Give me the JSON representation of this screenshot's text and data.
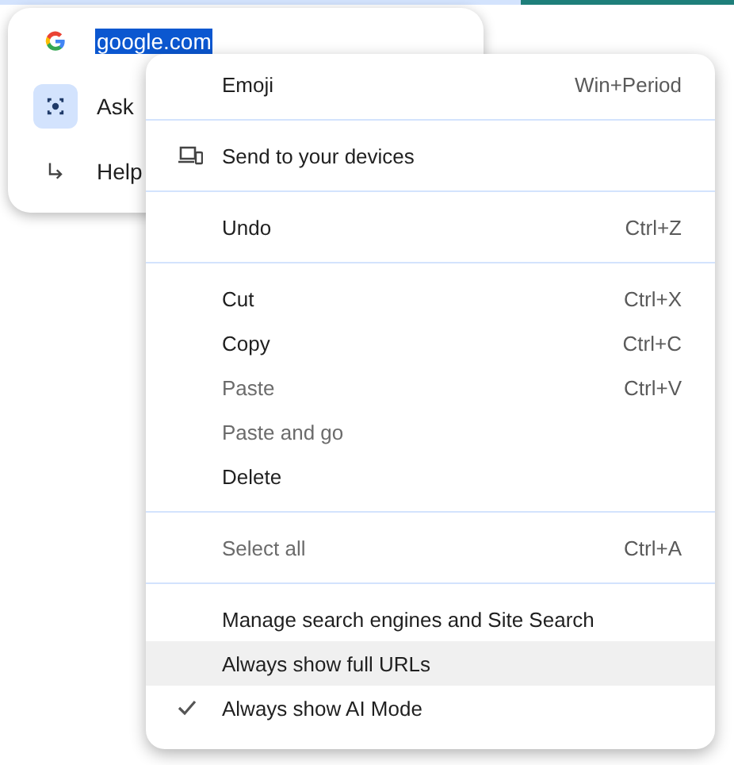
{
  "omnibox_popup": {
    "items": [
      {
        "kind": "site",
        "label": "google.com",
        "selected": true
      },
      {
        "kind": "lens",
        "label": "Ask",
        "selected": false
      },
      {
        "kind": "help",
        "label": "Help",
        "selected": false
      }
    ]
  },
  "context_menu": {
    "groups": [
      [
        {
          "kind": "plain",
          "label": "Emoji",
          "shortcut": "Win+Period",
          "disabled": false,
          "highlighted": false,
          "checked": false
        }
      ],
      [
        {
          "kind": "devices",
          "label": "Send to your devices",
          "disabled": false,
          "highlighted": false,
          "checked": false
        }
      ],
      [
        {
          "kind": "plain",
          "label": "Undo",
          "shortcut": "Ctrl+Z",
          "disabled": false,
          "highlighted": false,
          "checked": false
        }
      ],
      [
        {
          "kind": "plain",
          "label": "Cut",
          "shortcut": "Ctrl+X",
          "disabled": false,
          "highlighted": false,
          "checked": false
        },
        {
          "kind": "plain",
          "label": "Copy",
          "shortcut": "Ctrl+C",
          "disabled": false,
          "highlighted": false,
          "checked": false
        },
        {
          "kind": "plain",
          "label": "Paste",
          "shortcut": "Ctrl+V",
          "disabled": true,
          "highlighted": false,
          "checked": false
        },
        {
          "kind": "plain",
          "label": "Paste and go",
          "disabled": true,
          "highlighted": false,
          "checked": false
        },
        {
          "kind": "plain",
          "label": "Delete",
          "disabled": false,
          "highlighted": false,
          "checked": false
        }
      ],
      [
        {
          "kind": "plain",
          "label": "Select all",
          "shortcut": "Ctrl+A",
          "disabled": true,
          "highlighted": false,
          "checked": false
        }
      ],
      [
        {
          "kind": "plain",
          "label": "Manage search engines and Site Search",
          "disabled": false,
          "highlighted": false,
          "checked": false
        },
        {
          "kind": "plain",
          "label": "Always show full URLs",
          "disabled": false,
          "highlighted": true,
          "checked": false
        },
        {
          "kind": "plain",
          "label": "Always show AI Mode",
          "disabled": false,
          "highlighted": false,
          "checked": true
        }
      ]
    ]
  }
}
